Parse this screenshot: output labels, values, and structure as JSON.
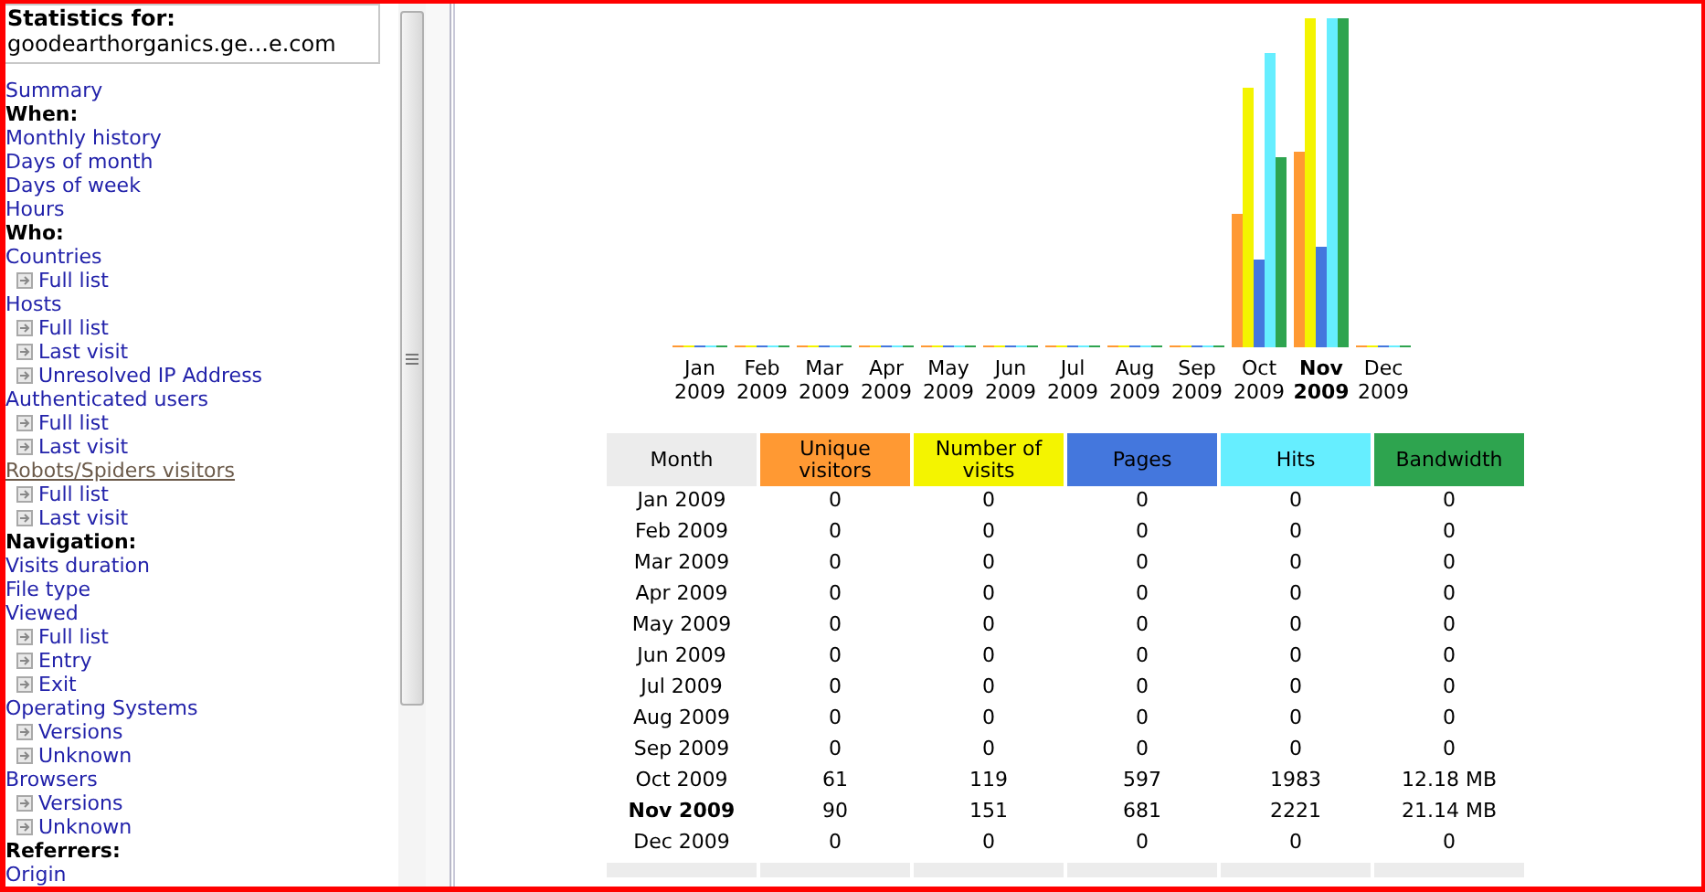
{
  "sidebar": {
    "title": "Statistics for:",
    "site": "goodearthorganics.ge...e.com",
    "items": [
      {
        "kind": "link",
        "label": "Summary",
        "highlighted": false
      },
      {
        "kind": "heading",
        "label": "When:"
      },
      {
        "kind": "link",
        "label": "Monthly history",
        "highlighted": false
      },
      {
        "kind": "link",
        "label": "Days of month",
        "highlighted": false
      },
      {
        "kind": "link",
        "label": "Days of week",
        "highlighted": false
      },
      {
        "kind": "link",
        "label": "Hours",
        "highlighted": false
      },
      {
        "kind": "heading",
        "label": "Who:"
      },
      {
        "kind": "link",
        "label": "Countries",
        "highlighted": false,
        "children": [
          {
            "label": "Full list"
          }
        ]
      },
      {
        "kind": "link",
        "label": "Hosts",
        "highlighted": false,
        "children": [
          {
            "label": "Full list"
          },
          {
            "label": "Last visit"
          },
          {
            "label": "Unresolved IP Address"
          }
        ]
      },
      {
        "kind": "link",
        "label": "Authenticated users",
        "highlighted": false,
        "children": [
          {
            "label": "Full list"
          },
          {
            "label": "Last visit"
          }
        ]
      },
      {
        "kind": "link",
        "label": "Robots/Spiders visitors",
        "highlighted": true,
        "children": [
          {
            "label": "Full list"
          },
          {
            "label": "Last visit"
          }
        ]
      },
      {
        "kind": "heading",
        "label": "Navigation:"
      },
      {
        "kind": "link",
        "label": "Visits duration",
        "highlighted": false
      },
      {
        "kind": "link",
        "label": "File type",
        "highlighted": false
      },
      {
        "kind": "link",
        "label": "Viewed",
        "highlighted": false,
        "children": [
          {
            "label": "Full list"
          },
          {
            "label": "Entry"
          },
          {
            "label": "Exit"
          }
        ]
      },
      {
        "kind": "link",
        "label": "Operating Systems",
        "highlighted": false,
        "children": [
          {
            "label": "Versions"
          },
          {
            "label": "Unknown"
          }
        ]
      },
      {
        "kind": "link",
        "label": "Browsers",
        "highlighted": false,
        "children": [
          {
            "label": "Versions"
          },
          {
            "label": "Unknown"
          }
        ]
      },
      {
        "kind": "heading",
        "label": "Referrers:"
      },
      {
        "kind": "link",
        "label": "Origin",
        "highlighted": false
      }
    ]
  },
  "chart": {
    "labels": [
      {
        "month": "Jan",
        "year": "2009",
        "current": false
      },
      {
        "month": "Feb",
        "year": "2009",
        "current": false
      },
      {
        "month": "Mar",
        "year": "2009",
        "current": false
      },
      {
        "month": "Apr",
        "year": "2009",
        "current": false
      },
      {
        "month": "May",
        "year": "2009",
        "current": false
      },
      {
        "month": "Jun",
        "year": "2009",
        "current": false
      },
      {
        "month": "Jul",
        "year": "2009",
        "current": false
      },
      {
        "month": "Aug",
        "year": "2009",
        "current": false
      },
      {
        "month": "Sep",
        "year": "2009",
        "current": false
      },
      {
        "month": "Oct",
        "year": "2009",
        "current": false
      },
      {
        "month": "Nov",
        "year": "2009",
        "current": true
      },
      {
        "month": "Dec",
        "year": "2009",
        "current": false
      }
    ]
  },
  "table": {
    "columns": [
      {
        "label": "Month",
        "color": "#ececec"
      },
      {
        "label": "Unique visitors",
        "color": "#ff9933"
      },
      {
        "label": "Number of visits",
        "color": "#f4f400"
      },
      {
        "label": "Pages",
        "color": "#4477dd"
      },
      {
        "label": "Hits",
        "color": "#66eeff"
      },
      {
        "label": "Bandwidth",
        "color": "#2ea44f"
      }
    ],
    "rows": [
      {
        "current": false,
        "cells": [
          "Jan 2009",
          "0",
          "0",
          "0",
          "0",
          "0"
        ]
      },
      {
        "current": false,
        "cells": [
          "Feb 2009",
          "0",
          "0",
          "0",
          "0",
          "0"
        ]
      },
      {
        "current": false,
        "cells": [
          "Mar 2009",
          "0",
          "0",
          "0",
          "0",
          "0"
        ]
      },
      {
        "current": false,
        "cells": [
          "Apr 2009",
          "0",
          "0",
          "0",
          "0",
          "0"
        ]
      },
      {
        "current": false,
        "cells": [
          "May 2009",
          "0",
          "0",
          "0",
          "0",
          "0"
        ]
      },
      {
        "current": false,
        "cells": [
          "Jun 2009",
          "0",
          "0",
          "0",
          "0",
          "0"
        ]
      },
      {
        "current": false,
        "cells": [
          "Jul 2009",
          "0",
          "0",
          "0",
          "0",
          "0"
        ]
      },
      {
        "current": false,
        "cells": [
          "Aug 2009",
          "0",
          "0",
          "0",
          "0",
          "0"
        ]
      },
      {
        "current": false,
        "cells": [
          "Sep 2009",
          "0",
          "0",
          "0",
          "0",
          "0"
        ]
      },
      {
        "current": false,
        "cells": [
          "Oct 2009",
          "61",
          "119",
          "597",
          "1983",
          "12.18 MB"
        ]
      },
      {
        "current": true,
        "cells": [
          "Nov 2009",
          "90",
          "151",
          "681",
          "2221",
          "21.14 MB"
        ]
      },
      {
        "current": false,
        "cells": [
          "Dec 2009",
          "0",
          "0",
          "0",
          "0",
          "0"
        ]
      }
    ]
  }
}
